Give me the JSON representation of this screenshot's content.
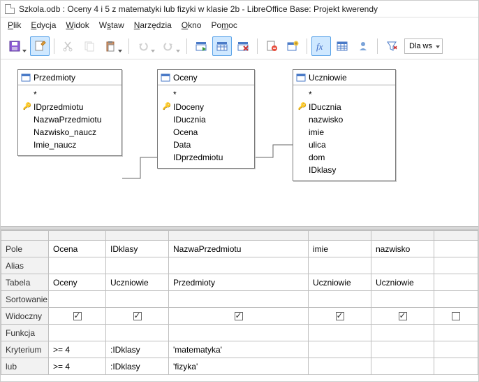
{
  "title": "Szkola.odb : Oceny 4 i 5 z matematyki lub fizyki w klasie 2b - LibreOffice Base: Projekt kwerendy",
  "menu": {
    "file": "Plik",
    "edit": "Edycja",
    "view": "Widok",
    "insert": "Wstaw",
    "tools": "Narzędzia",
    "window": "Okno",
    "help": "Pomoc"
  },
  "toolbar": {
    "limit_label": "Dla ws"
  },
  "tables": {
    "przedmioty": {
      "title": "Przedmioty",
      "fields": [
        "IDprzedmiotu",
        "NazwaPrzedmiotu",
        "Nazwisko_naucz",
        "Imie_naucz"
      ],
      "keys": [
        true,
        false,
        false,
        false
      ]
    },
    "oceny": {
      "title": "Oceny",
      "fields": [
        "IDoceny",
        "IDucznia",
        "Ocena",
        "Data",
        "IDprzedmiotu"
      ],
      "keys": [
        true,
        false,
        false,
        false,
        false
      ]
    },
    "uczniowie": {
      "title": "Uczniowie",
      "fields": [
        "IDucznia",
        "nazwisko",
        "imie",
        "ulica",
        "dom",
        "IDklasy"
      ],
      "keys": [
        true,
        false,
        false,
        false,
        false,
        false
      ]
    }
  },
  "grid": {
    "row_labels": {
      "field": "Pole",
      "alias": "Alias",
      "table": "Tabela",
      "sort": "Sortowanie",
      "visible": "Widoczny",
      "function": "Funkcja",
      "criterion": "Kryterium",
      "or": "lub"
    },
    "columns": [
      {
        "field": "Ocena",
        "table": "Oceny",
        "visible": true,
        "criterion": ">= 4",
        "or": ">= 4"
      },
      {
        "field": "IDklasy",
        "table": "Uczniowie",
        "visible": true,
        "criterion": ":IDklasy",
        "or": ":IDklasy"
      },
      {
        "field": "NazwaPrzedmiotu",
        "table": "Przedmioty",
        "visible": true,
        "criterion": "'matematyka'",
        "or": "'fizyka'"
      },
      {
        "field": "imie",
        "table": "Uczniowie",
        "visible": true,
        "criterion": "",
        "or": ""
      },
      {
        "field": "nazwisko",
        "table": "Uczniowie",
        "visible": true,
        "criterion": "",
        "or": ""
      }
    ]
  }
}
